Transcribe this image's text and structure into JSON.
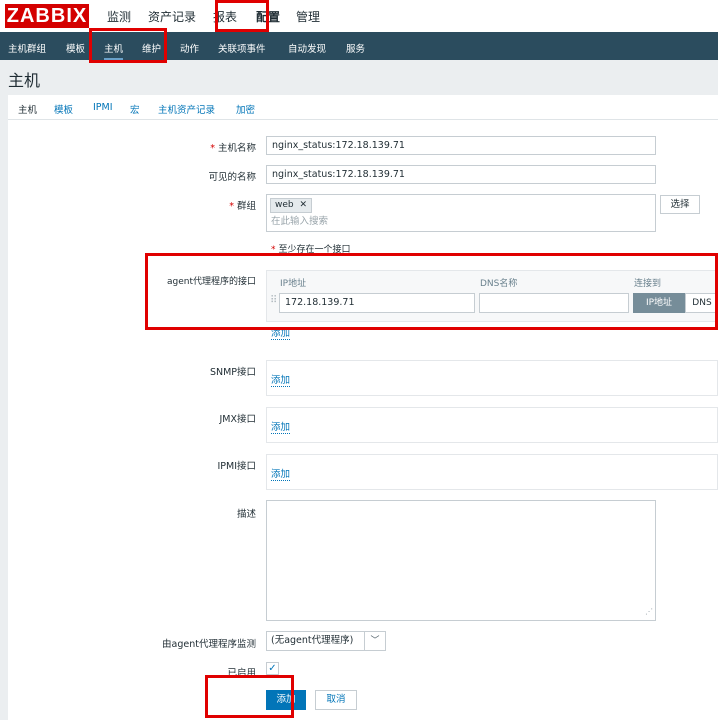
{
  "header": {
    "logo": "ZABBIX",
    "nav": [
      "监测",
      "资产记录",
      "报表",
      "配置",
      "管理"
    ]
  },
  "subnav": [
    "主机群组",
    "模板",
    "主机",
    "维护",
    "动作",
    "关联项事件",
    "自动发现",
    "服务"
  ],
  "page_title": "主机",
  "tabs": [
    "主机",
    "模板",
    "IPMI",
    "宏",
    "主机资产记录",
    "加密"
  ],
  "form": {
    "host_name_label": "主机名称",
    "host_name_value": "nginx_status:172.18.139.71",
    "visible_name_label": "可见的名称",
    "visible_name_value": "nginx_status:172.18.139.71",
    "groups_label": "群组",
    "group_tag": "web",
    "group_search_placeholder": "在此输入搜索",
    "select_button": "选择",
    "interface_required_note": "至少存在一个接口",
    "agent_interface_label": "agent代理程序的接口",
    "col_ip": "IP地址",
    "col_dns": "DNS名称",
    "col_connect": "连接到",
    "ip_value": "172.18.139.71",
    "dns_value": "",
    "connect_ip": "IP地址",
    "connect_dns": "DNS",
    "add_link": "添加",
    "snmp_label": "SNMP接口",
    "jmx_label": "JMX接口",
    "ipmi_label": "IPMI接口",
    "description_label": "描述",
    "proxy_label": "由agent代理程序监测",
    "proxy_value": "(无agent代理程序)",
    "enabled_label": "已启用",
    "enabled": true,
    "add_button": "添加",
    "cancel_button": "取消"
  },
  "colors": {
    "brand": "#d40000",
    "subnav_bg": "#2b4c5e",
    "link": "#0275b8",
    "primary_button": "#0275b8",
    "annotation": "#e00000"
  }
}
